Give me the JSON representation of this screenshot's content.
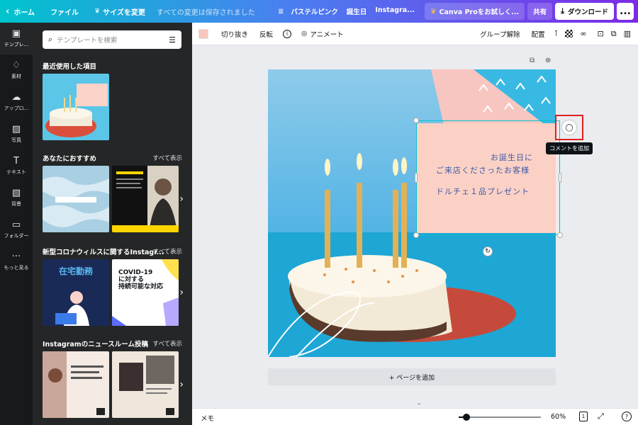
{
  "topbar": {
    "home": "ホーム",
    "file": "ファイル",
    "resize": "サイズを変更",
    "saved_status": "すべての変更は保存されました",
    "doc_title_parts": [
      "パステルピンク",
      "誕生日",
      "Instagra..."
    ],
    "try_pro": "Canva Proをお試しく...",
    "share": "共有",
    "download": "ダウンロード",
    "more": "..."
  },
  "rail": {
    "items": [
      {
        "label": "テンプレ...",
        "icon": "template-icon"
      },
      {
        "label": "素材",
        "icon": "elements-icon"
      },
      {
        "label": "アップロ...",
        "icon": "upload-icon"
      },
      {
        "label": "写真",
        "icon": "photo-icon"
      },
      {
        "label": "テキスト",
        "icon": "text-icon"
      },
      {
        "label": "背景",
        "icon": "background-icon"
      },
      {
        "label": "フォルダー",
        "icon": "folder-icon"
      },
      {
        "label": "もっと見る",
        "icon": "more-icon"
      }
    ]
  },
  "panel": {
    "search_placeholder": "テンプレートを検索",
    "recent_title": "最近使用した項目",
    "recommended_title": "あなたにおすすめ",
    "covid_title": "新型コロナウィルスに関するInstagr...",
    "newsroom_title": "Instagramのニュースルーム投稿",
    "see_all": "すべて表示",
    "covid_thumb1_text": "在宅勤務",
    "covid_thumb2_text": "COVID-19\nに対する\n持続可能な対応"
  },
  "toolbar": {
    "crop": "切り抜き",
    "flip": "反転",
    "animate": "アニメート",
    "ungroup": "グループ解除",
    "arrange": "配置",
    "fill_color": "#f9c6bb"
  },
  "design": {
    "line1": "お誕生日に",
    "line2": "ご来店くださったお客様",
    "line3": "ドルチェ１品プレゼント"
  },
  "comment_tooltip": "コメントを追加",
  "add_page": "+ ページを追加",
  "bottombar": {
    "notes": "メモ",
    "zoom": "60%",
    "page_number": "1",
    "help": "?",
    "zoom_level": 0.6
  }
}
